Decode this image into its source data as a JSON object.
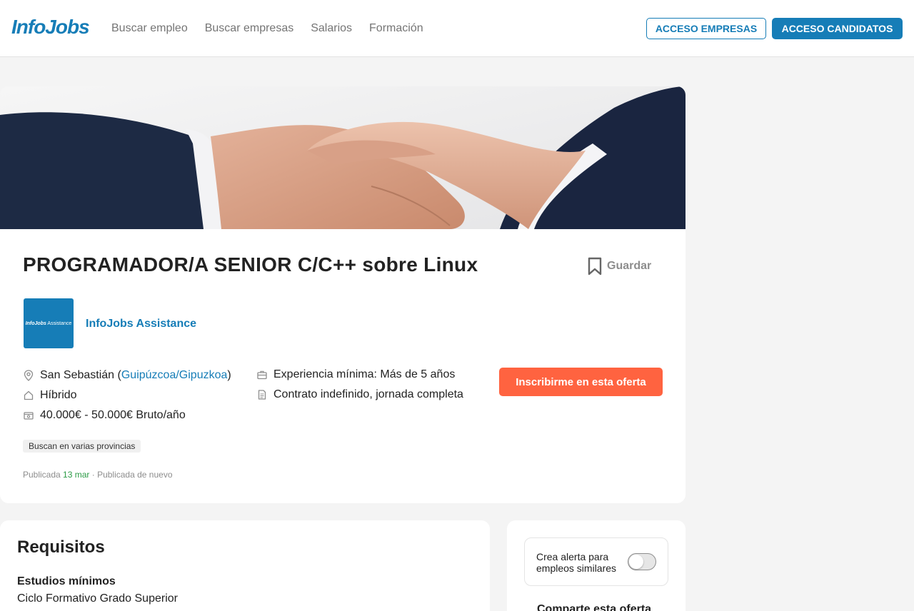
{
  "header": {
    "logo": "InfoJobs",
    "nav": [
      "Buscar empleo",
      "Buscar empresas",
      "Salarios",
      "Formación"
    ],
    "btn_empresas": "ACCESO EMPRESAS",
    "btn_candidatos": "ACCESO CANDIDATOS"
  },
  "job": {
    "title": "PROGRAMADOR/A SENIOR C/C++ sobre Linux",
    "save_label": "Guardar",
    "company_logo_text_bold": "InfoJobs",
    "company_logo_text": " Assistance",
    "company_name": "InfoJobs Assistance",
    "location_city": "San Sebastián (",
    "location_link": "Guipúzcoa/Gipuzkoa",
    "location_close": ")",
    "modality": "Híbrido",
    "salary": "40.000€ - 50.000€ Bruto/año",
    "experience": "Experiencia mínima: Más de 5 años",
    "contract": "Contrato indefinido, jornada completa",
    "apply_label": "Inscribirme en esta oferta",
    "tag": "Buscan en varias provincias",
    "pub_prefix": "Publicada ",
    "pub_date": "13 mar",
    "pub_suffix": " · Publicada de nuevo"
  },
  "requirements": {
    "title": "Requisitos",
    "studies_label": "Estudios mínimos",
    "studies_value": "Ciclo Formativo Grado Superior"
  },
  "sidebar": {
    "alert_text": "Crea alerta para empleos similares",
    "alert_enabled": false,
    "share_title": "Comparte esta oferta"
  },
  "colors": {
    "brand": "#167db7",
    "apply": "#ff6340",
    "date_green": "#2b9b45"
  }
}
